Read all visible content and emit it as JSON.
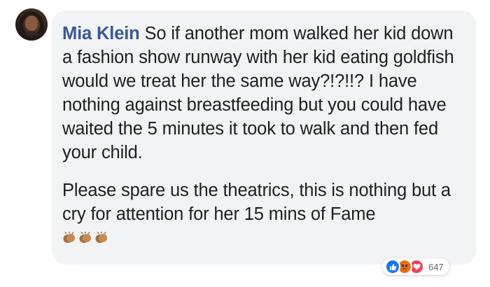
{
  "comment": {
    "author": "Mia Klein",
    "paragraph_1": "So if another mom walked her kid down a fashion show runway with her kid eating goldfish would we treat her the same way?!?!!? I have nothing against breastfeeding but you could have waited the 5 minutes it took to walk and then fed your child.",
    "paragraph_2": "Please spare us the theatrics, this is nothing but a cry for attention for her 15 mins of Fame",
    "emoji_icons": [
      "clapping-hands-icon",
      "clapping-hands-icon",
      "clapping-hands-icon"
    ]
  },
  "reactions": {
    "icons": [
      "like-icon",
      "angry-icon",
      "love-icon"
    ],
    "count": "647"
  },
  "colors": {
    "author": "#385898",
    "bubble": "#f2f3f5",
    "text": "#1c1e21",
    "like": "#1877f2",
    "angry": "#e9710f",
    "love": "#f33e58"
  }
}
